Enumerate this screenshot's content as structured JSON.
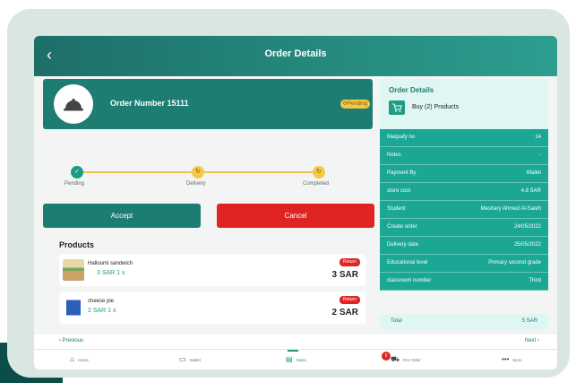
{
  "topbar": {
    "title": "Order Details",
    "back_icon": "chevron-left-icon"
  },
  "order": {
    "number_label": "Order Number 15111",
    "status_badge": "⟳Pending",
    "icon": "cloche-icon"
  },
  "timeline": {
    "steps": [
      {
        "label": "Pending",
        "state": "done",
        "icon": "check-icon"
      },
      {
        "label": "Delivery",
        "state": "pending",
        "icon": "refresh-icon"
      },
      {
        "label": "Completed",
        "state": "pending",
        "icon": "refresh-icon"
      }
    ]
  },
  "actions": {
    "accept_label": "Accept",
    "cancel_label": "Cancel"
  },
  "products": {
    "title": "Products",
    "items": [
      {
        "name": "Halloumi sandwich",
        "price": "3 SAR   1 x",
        "return_label": "Return",
        "total": "3 SAR"
      },
      {
        "name": "cheese pie",
        "price": "2 SAR   1 x",
        "return_label": "Return",
        "total": "2 SAR"
      }
    ]
  },
  "summary": {
    "title": "Order Details",
    "cart_label": "Buy (2) Products",
    "cart_icon": "cart-icon",
    "rows": [
      {
        "key": "Maqsafy no",
        "value": "14"
      },
      {
        "key": "Notes",
        "value": "-"
      },
      {
        "key": "Payment By",
        "value": "Wallet"
      },
      {
        "key": "store cost",
        "value": "4.8 SAR"
      },
      {
        "key": "Student",
        "value": "Meshary Ahmed Al-Saleh"
      },
      {
        "key": "Create order",
        "value": "24/05/2022"
      },
      {
        "key": "Delivery date",
        "value": "25/05/2022"
      },
      {
        "key": "Educational level",
        "value": "Primary second grade"
      },
      {
        "key": "classroom number",
        "value": "Third"
      }
    ],
    "total_key": "Total",
    "total_value": "5 SAR"
  },
  "pager": {
    "previous": "‹ Previous",
    "next": "Next ›"
  },
  "nav": {
    "items": [
      {
        "label": "Home",
        "icon": "home-icon"
      },
      {
        "label": "Wallet",
        "icon": "wallet-icon"
      },
      {
        "label": "Sales",
        "icon": "sales-icon"
      },
      {
        "label": "Pre Order",
        "icon": "cart-icon",
        "badge": "5"
      },
      {
        "label": "More",
        "icon": "more-icon"
      }
    ]
  },
  "colors": {
    "primary": "#1e7d72",
    "accent": "#1aa794",
    "danger": "#e02424",
    "warning": "#f5c84a"
  }
}
